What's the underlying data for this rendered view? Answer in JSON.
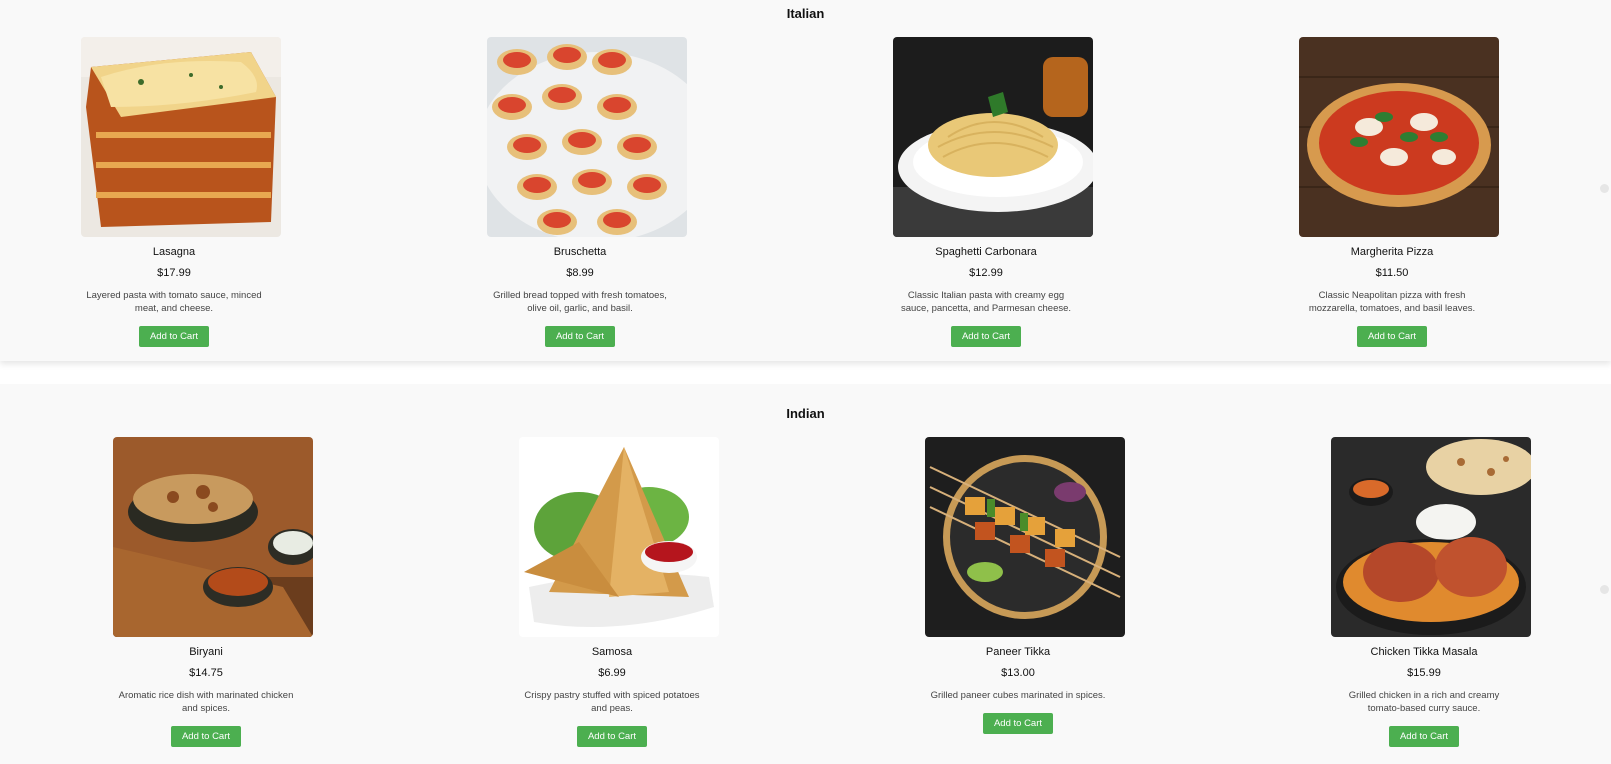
{
  "sections": [
    {
      "title": "Italian",
      "items": [
        {
          "name": "Lasagna",
          "price": "$17.99",
          "description": "Layered pasta with tomato sauce, minced meat, and cheese.",
          "button": "Add to Cart"
        },
        {
          "name": "Bruschetta",
          "price": "$8.99",
          "description": "Grilled bread topped with fresh tomatoes, olive oil, garlic, and basil.",
          "button": "Add to Cart"
        },
        {
          "name": "Spaghetti Carbonara",
          "price": "$12.99",
          "description": "Classic Italian pasta with creamy egg sauce, pancetta, and Parmesan cheese.",
          "button": "Add to Cart"
        },
        {
          "name": "Margherita Pizza",
          "price": "$11.50",
          "description": "Classic Neapolitan pizza with fresh mozzarella, tomatoes, and basil leaves.",
          "button": "Add to Cart"
        }
      ]
    },
    {
      "title": "Indian",
      "items": [
        {
          "name": "Biryani",
          "price": "$14.75",
          "description": "Aromatic rice dish with marinated chicken and spices.",
          "button": "Add to Cart"
        },
        {
          "name": "Samosa",
          "price": "$6.99",
          "description": "Crispy pastry stuffed with spiced potatoes and peas.",
          "button": "Add to Cart"
        },
        {
          "name": "Paneer Tikka",
          "price": "$13.00",
          "description": "Grilled paneer cubes marinated in spices.",
          "button": "Add to Cart"
        },
        {
          "name": "Chicken Tikka Masala",
          "price": "$15.99",
          "description": "Grilled chicken in a rich and creamy tomato-based curry sauce.",
          "button": "Add to Cart"
        }
      ]
    }
  ],
  "colors": {
    "button": "#4caf50",
    "background": "#f9f9f9"
  },
  "icons": [
    "lasagna-photo",
    "bruschetta-photo",
    "spaghetti-carbonara-photo",
    "margherita-pizza-photo",
    "biryani-photo",
    "samosa-photo",
    "paneer-tikka-photo",
    "chicken-tikka-masala-photo"
  ]
}
